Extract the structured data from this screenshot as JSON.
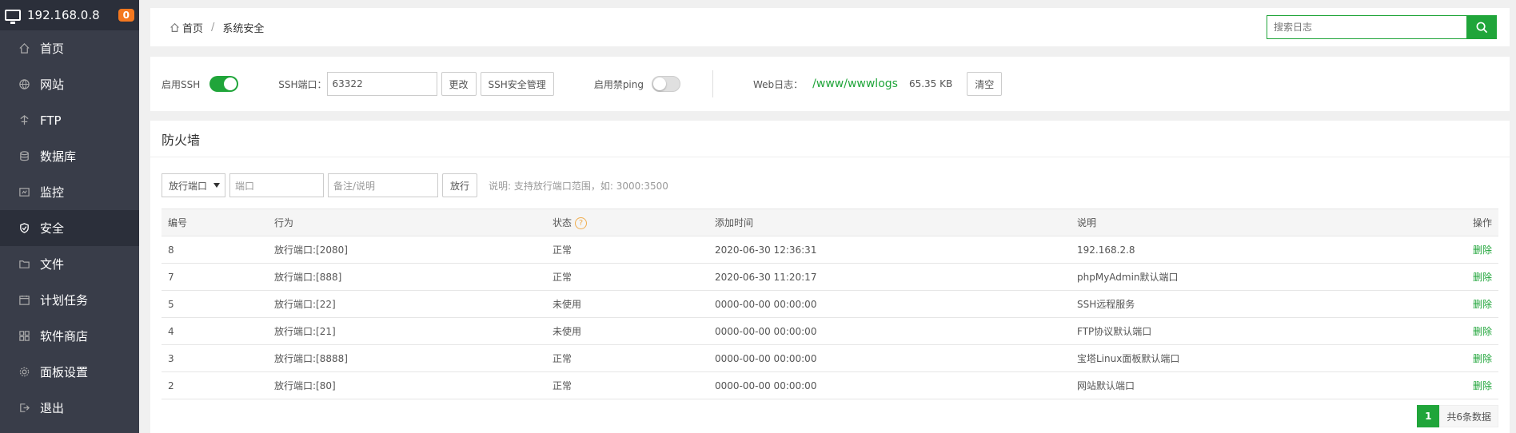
{
  "sidebar": {
    "ip": "192.168.0.8",
    "badge": "0",
    "items": [
      {
        "label": "首页",
        "icon": "home-icon"
      },
      {
        "label": "网站",
        "icon": "globe-icon"
      },
      {
        "label": "FTP",
        "icon": "ftp-icon"
      },
      {
        "label": "数据库",
        "icon": "database-icon"
      },
      {
        "label": "监控",
        "icon": "monitor-icon"
      },
      {
        "label": "安全",
        "icon": "shield-icon"
      },
      {
        "label": "文件",
        "icon": "folder-icon"
      },
      {
        "label": "计划任务",
        "icon": "calendar-icon"
      },
      {
        "label": "软件商店",
        "icon": "apps-icon"
      },
      {
        "label": "面板设置",
        "icon": "gear-icon"
      },
      {
        "label": "退出",
        "icon": "logout-icon"
      }
    ],
    "active_index": 5
  },
  "breadcrumb": {
    "home": "首页",
    "current": "系统安全"
  },
  "search": {
    "placeholder": "搜索日志"
  },
  "ssh": {
    "enable_label": "启用SSH",
    "enabled": true,
    "port_label": "SSH端口：",
    "port_value": "63322",
    "change_btn": "更改",
    "manage_btn": "SSH安全管理",
    "ping_label": "启用禁ping",
    "ping_enabled": false,
    "weblog_label": "Web日志：",
    "weblog_path": "/www/wwwlogs",
    "weblog_size": "65.35 KB",
    "clear_btn": "清空"
  },
  "firewall": {
    "title": "防火墙",
    "select_value": "放行端口",
    "port_placeholder": "端口",
    "note_placeholder": "备注/说明",
    "allow_btn": "放行",
    "hint": "说明: 支持放行端口范围，如: 3000:3500",
    "columns": [
      "编号",
      "行为",
      "状态",
      "添加时间",
      "说明",
      "操作"
    ],
    "rows": [
      {
        "id": "8",
        "action": "放行端口:[2080]",
        "status": "正常",
        "time": "2020-06-30 12:36:31",
        "desc": "192.168.2.8",
        "op": "删除"
      },
      {
        "id": "7",
        "action": "放行端口:[888]",
        "status": "正常",
        "time": "2020-06-30 11:20:17",
        "desc": "phpMyAdmin默认端口",
        "op": "删除"
      },
      {
        "id": "5",
        "action": "放行端口:[22]",
        "status": "未使用",
        "time": "0000-00-00 00:00:00",
        "desc": "SSH远程服务",
        "op": "删除"
      },
      {
        "id": "4",
        "action": "放行端口:[21]",
        "status": "未使用",
        "time": "0000-00-00 00:00:00",
        "desc": "FTP协议默认端口",
        "op": "删除"
      },
      {
        "id": "3",
        "action": "放行端口:[8888]",
        "status": "正常",
        "time": "0000-00-00 00:00:00",
        "desc": "宝塔Linux面板默认端口",
        "op": "删除"
      },
      {
        "id": "2",
        "action": "放行端口:[80]",
        "status": "正常",
        "time": "0000-00-00 00:00:00",
        "desc": "网站默认端口",
        "op": "删除"
      }
    ],
    "page": "1",
    "total": "共6条数据"
  },
  "colors": {
    "accent": "#20a53a",
    "sidebar_bg": "#393d49",
    "badge": "#f4781f"
  }
}
